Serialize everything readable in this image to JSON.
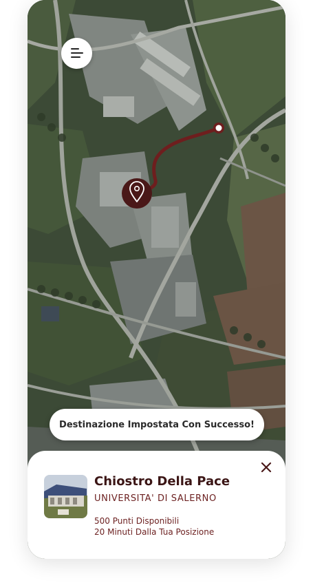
{
  "map": {
    "icons": {
      "menu": "menu-icon",
      "origin": "location-pin-icon",
      "destination": "destination-dot-icon"
    },
    "colors": {
      "route": "#6e1e1e",
      "pin": "#4a1818",
      "destination_dot": "#ffffff"
    }
  },
  "toast": {
    "message": "Destinazione Impostata Con Successo!"
  },
  "place_card": {
    "title": "Chiostro Della Pace",
    "subtitle": "UNIVERSITA' DI SALERNO",
    "points": "500 Punti Disponibili",
    "distance": "20 Minuti Dalla Tua Posizione",
    "close_icon": "close-icon",
    "colors": {
      "accent": "#6b1f1f",
      "title": "#3b1515"
    }
  }
}
